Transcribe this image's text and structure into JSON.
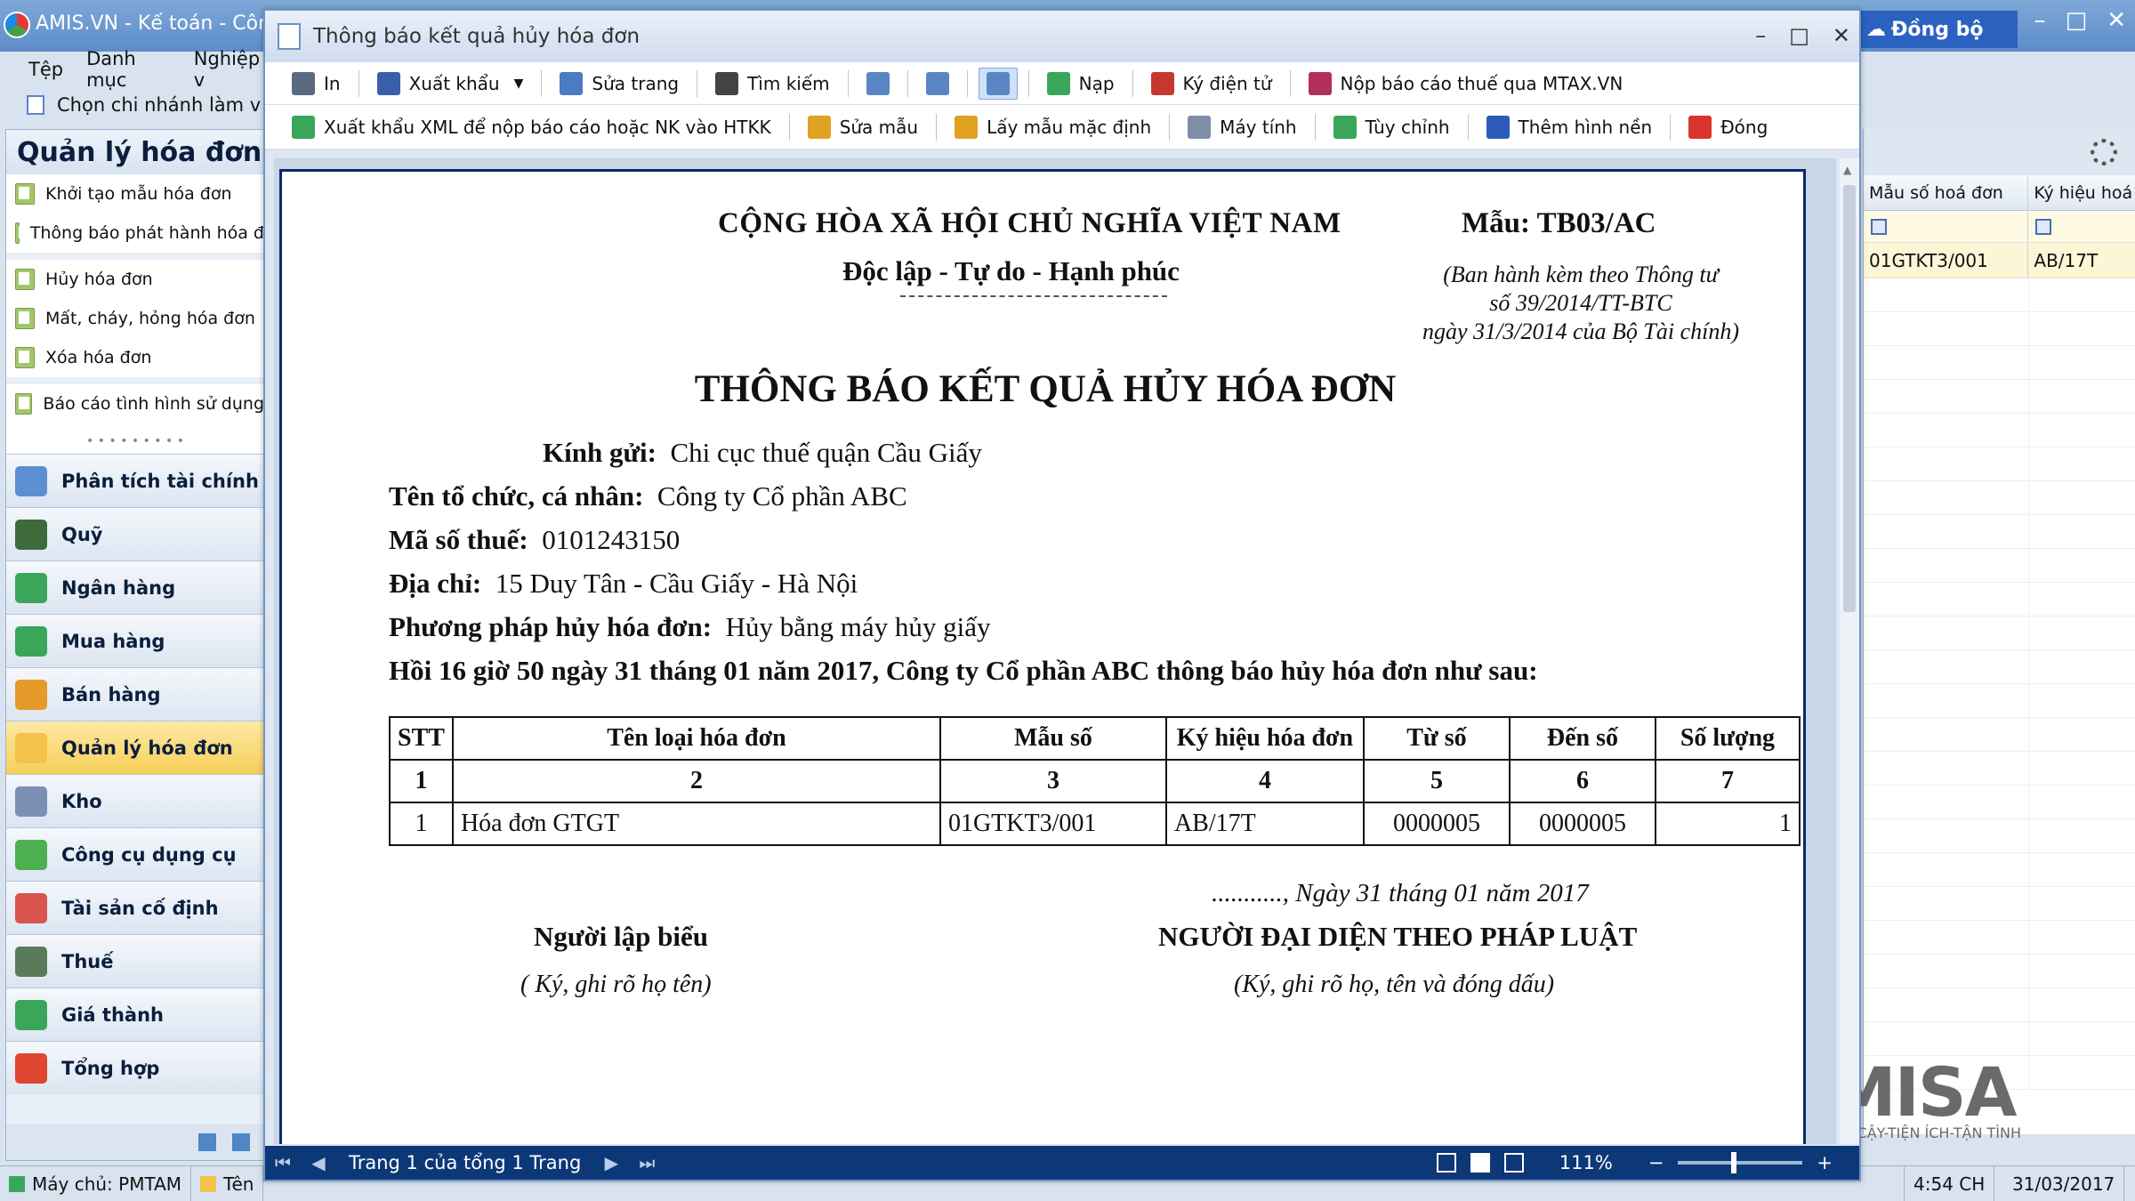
{
  "app": {
    "title": "AMIS.VN - Kế toán - Công",
    "sync_label": "Đồng bộ",
    "menu": [
      "Tệp",
      "Danh mục",
      "Nghiệp v"
    ],
    "branch_label": "Chọn chi nhánh làm v",
    "win_controls": [
      "–",
      "□",
      "✕"
    ]
  },
  "sidebar": {
    "header": "Quản lý hóa đơn",
    "tasks": [
      "Khởi tạo mẫu hóa đơn",
      "Thông báo phát hành hóa đ",
      "Hủy hóa đơn",
      "Mất, cháy, hỏng hóa đơn",
      "Xóa hóa đơn",
      "Báo cáo tình hình sử dụng"
    ],
    "nav": [
      {
        "label": "Phân tích tài chính",
        "color": "#5b8fd1"
      },
      {
        "label": "Quỹ",
        "color": "#3d6b3a"
      },
      {
        "label": "Ngân hàng",
        "color": "#3aa65a"
      },
      {
        "label": "Mua hàng",
        "color": "#3aa65a"
      },
      {
        "label": "Bán hàng",
        "color": "#e59b2a"
      },
      {
        "label": "Quản lý hóa đơn",
        "color": "#f2c24a"
      },
      {
        "label": "Kho",
        "color": "#7b8fb5"
      },
      {
        "label": "Công cụ dụng cụ",
        "color": "#4caf50"
      },
      {
        "label": "Tài sản cố định",
        "color": "#d9534f"
      },
      {
        "label": "Thuế",
        "color": "#5a7b5a"
      },
      {
        "label": "Giá thành",
        "color": "#3aa65a"
      },
      {
        "label": "Tổng hợp",
        "color": "#e0452f"
      }
    ],
    "active_index": 5
  },
  "status": {
    "server": "Máy chủ: PMTAM",
    "name": "Tên",
    "time": "4:54 CH",
    "date": "31/03/2017"
  },
  "rgrid": {
    "col1": "Mẫu số hoá đơn",
    "col2": "Ký hiệu hoá",
    "row": [
      "01GTKT3/001",
      "AB/17T"
    ]
  },
  "brand": {
    "logo_text": "MISA",
    "tagline": "TIN CẬY-TIỆN ÍCH-TẬN TÌNH"
  },
  "dialog": {
    "title": "Thông báo kết quả hủy hóa đơn",
    "win_controls": [
      "–",
      "□",
      "✕"
    ],
    "toolbar1": [
      {
        "label": "In",
        "icon": "printer-icon",
        "color": "#5a6b80"
      },
      {
        "label": "Xuất khẩu",
        "icon": "save-icon",
        "color": "#3b5fa8",
        "caret": true
      },
      {
        "label": "Sửa trang",
        "icon": "edit-page-icon",
        "color": "#4b7bc2"
      },
      {
        "label": "Tìm kiếm",
        "icon": "binoculars-icon",
        "color": "#444"
      },
      {
        "label": "",
        "icon": "page-icon",
        "color": "#5a86c6"
      },
      {
        "label": "",
        "icon": "page-width-icon",
        "color": "#5a86c6"
      },
      {
        "label": "",
        "icon": "fit-page-icon",
        "color": "#5a86c6",
        "pressed": true
      },
      {
        "label": "Nạp",
        "icon": "refresh-icon",
        "color": "#3aa65a"
      },
      {
        "label": "Ký điện tử",
        "icon": "signature-icon",
        "color": "#c6372d"
      },
      {
        "label": "Nộp báo cáo thuế qua MTAX.VN",
        "icon": "mtax-icon",
        "color": "#b0305a"
      }
    ],
    "toolbar2": [
      {
        "label": "Xuất khẩu XML để nộp báo cáo hoặc NK vào HTKK",
        "icon": "xml-export-icon",
        "color": "#3aa65a"
      },
      {
        "label": "Sửa mẫu",
        "icon": "edit-template-icon",
        "color": "#e0a020"
      },
      {
        "label": "Lấy mẫu mặc định",
        "icon": "default-template-icon",
        "color": "#e0a020"
      },
      {
        "label": "Máy tính",
        "icon": "calculator-icon",
        "color": "#7f8fa8"
      },
      {
        "label": "Tùy chỉnh",
        "icon": "customize-icon",
        "color": "#3aa65a"
      },
      {
        "label": "Thêm hình nền",
        "icon": "background-icon",
        "color": "#2a5cb8"
      },
      {
        "label": "Đóng",
        "icon": "close-icon",
        "color": "#d9342b"
      }
    ],
    "nav": {
      "page_text": "Trang 1 của tổng 1 Trang",
      "zoom": "111%"
    }
  },
  "document": {
    "republic": "CỘNG HÒA XÃ HỘI CHỦ NGHĨA VIỆT NAM",
    "motto": "Độc lập - Tự do - Hạnh phúc",
    "form_code": "Mẫu: TB03/AC",
    "circular": [
      "(Ban hành kèm theo Thông tư",
      "số 39/2014/TT-BTC",
      "ngày 31/3/2014 của Bộ Tài chính)"
    ],
    "title": "THÔNG BÁO KẾT QUẢ HỦY HÓA ĐƠN",
    "to_label": "Kính gửi:",
    "to_value": "Chi cục thuế quận Cầu Giấy",
    "org_label": "Tên tổ chức, cá nhân:",
    "org_value": "Công ty Cổ phần ABC",
    "tax_label": "Mã số thuế:",
    "tax_value": "0101243150",
    "addr_label": "Địa chỉ:",
    "addr_value": "15 Duy Tân - Cầu Giấy - Hà Nội",
    "method_label": "Phương pháp hủy hóa đơn:",
    "method_value": "Hủy bằng máy hủy giấy",
    "statement": "Hồi 16 giờ 50 ngày 31 tháng 01 năm 2017, Công ty Cổ phần ABC thông báo hủy hóa đơn như sau:",
    "table": {
      "headers": [
        "STT",
        "Tên loại hóa đơn",
        "Mẫu số",
        "Ký hiệu hóa đơn",
        "Từ số",
        "Đến số",
        "Số lượng"
      ],
      "numbers": [
        "1",
        "2",
        "3",
        "4",
        "5",
        "6",
        "7"
      ],
      "row": [
        "1",
        "Hóa đơn GTGT",
        "01GTKT3/001",
        "AB/17T",
        "0000005",
        "0000005",
        "1"
      ]
    },
    "date_line": "..........., Ngày 31 tháng 01 năm 2017",
    "preparer_title": "Người lập biểu",
    "preparer_note": "( Ký, ghi rõ họ tên)",
    "rep_title": "NGƯỜI ĐẠI DIỆN THEO PHÁP LUẬT",
    "rep_note": "(Ký, ghi rõ họ, tên và đóng dấu)"
  }
}
